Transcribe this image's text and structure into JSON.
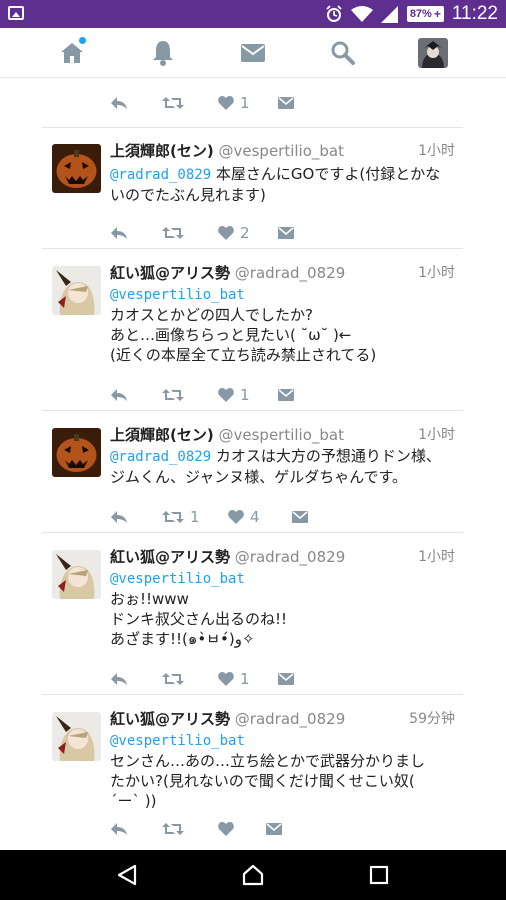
{
  "status_bar": {
    "battery": "87%",
    "battery_plus": "+",
    "time": "11:22",
    "icons": [
      "gallery-icon",
      "alarm-icon",
      "wifi-icon",
      "signal-icon",
      "battery-icon"
    ],
    "background": "#5e2f8f"
  },
  "nav": {
    "items": [
      "home-icon",
      "notifications-icon",
      "messages-icon",
      "search-icon",
      "profile-avatar"
    ],
    "accent": "#1da1f2"
  },
  "top_partial": {
    "likes": "1"
  },
  "tweets": [
    {
      "name": "上須輝郎(セン)",
      "handle": "@vespertilio_bat",
      "time": "1小时",
      "mention": "@radrad_0829",
      "text_inline": " 本屋さんにGOですよ(付録とかな",
      "text": "いのでたぶん見れます)",
      "retweets": "",
      "likes": "2"
    },
    {
      "name": "紅い狐@アリス勢",
      "handle": "@radrad_0829",
      "time": "1小时",
      "mention": "@vespertilio_bat",
      "text": "カオスとかどの四人でしたか?\nあと…画像ちらっと見たい( ˘ω˘ )←\n(近くの本屋全て立ち読み禁止されてる)",
      "retweets": "",
      "likes": "1"
    },
    {
      "name": "上須輝郎(セン)",
      "handle": "@vespertilio_bat",
      "time": "1小时",
      "mention": "@radrad_0829",
      "text_inline": " カオスは大方の予想通りドン様、",
      "text": "ジムくん、ジャンヌ様、ゲルダちゃんです。",
      "retweets": "1",
      "likes": "4"
    },
    {
      "name": "紅い狐@アリス勢",
      "handle": "@radrad_0829",
      "time": "1小时",
      "mention": "@vespertilio_bat",
      "text": "おぉ!!www\nドンキ叔父さん出るのね!!\nあざます!!(๑•̀ㅂ•́)و✧",
      "retweets": "",
      "likes": "1"
    },
    {
      "name": "紅い狐@アリス勢",
      "handle": "@radrad_0829",
      "time": "59分钟",
      "mention": "@vespertilio_bat",
      "text": "センさん…あの…立ち絵とかで武器分かりまし\nたかい?(見れないので聞くだけ聞くせこい奴(\n´ー` ))",
      "retweets": "",
      "likes": ""
    }
  ],
  "system_nav": [
    "back-icon",
    "home-circle-icon",
    "recents-icon"
  ]
}
